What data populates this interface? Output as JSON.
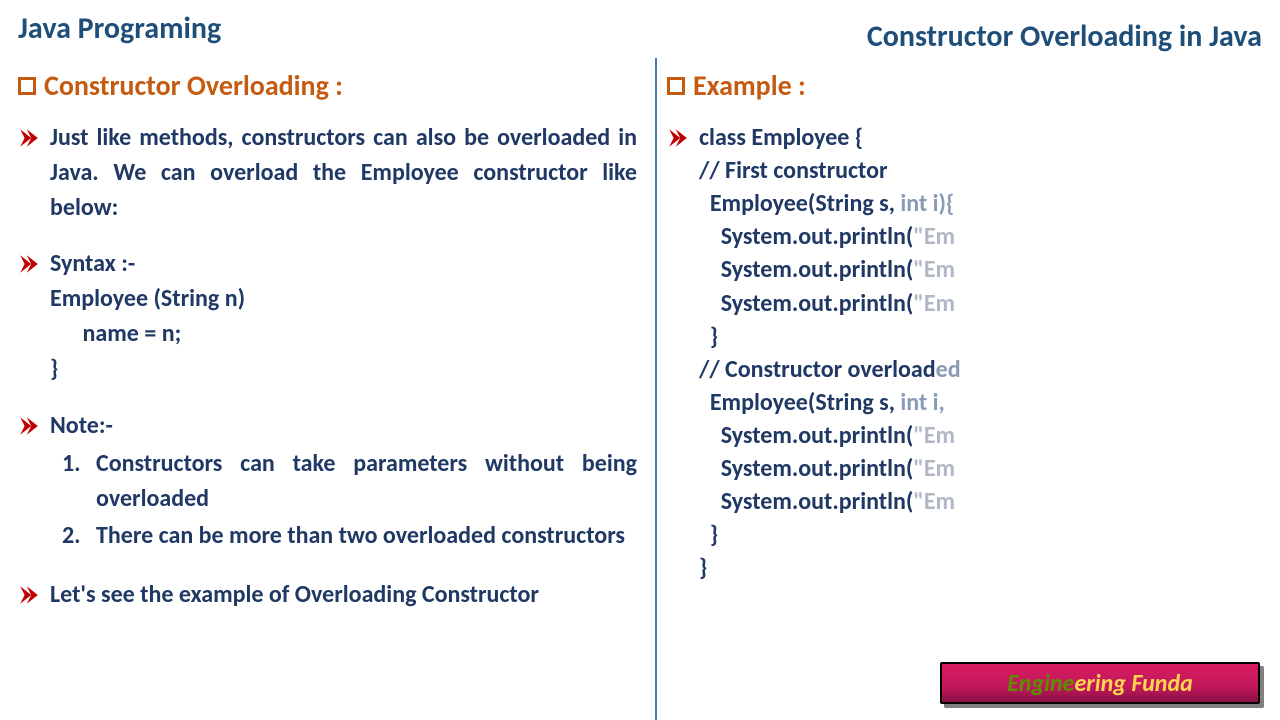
{
  "header": {
    "left": "Java Programing",
    "right": "Constructor Overloading in Java"
  },
  "left": {
    "title": "Constructor Overloading :",
    "para1": "Just like methods, constructors can also be overloaded in Java. We can overload the Employee constructor like below:",
    "syntax_label": "Syntax :-",
    "syntax_l1": "Employee (String n)",
    "syntax_l2": "      name = n;",
    "syntax_l3": "}",
    "note_label": "Note:-",
    "note1": "Constructors can take parameters without being overloaded",
    "note2": "There can be more than two overloaded constructors",
    "para2": "Let's see the example of Overloading Constructor"
  },
  "right": {
    "title": "Example :",
    "code": {
      "l1": "class Employee {",
      "l2": "// First constructor",
      "l3a": "  Employee(String s, ",
      "l3b": "int i){",
      "l4a": "    System.out.println(",
      "l4b": "\"Em",
      "l5a": "    System.out.println(",
      "l5b": "\"Em",
      "l6a": "    System.out.println(",
      "l6b": "\"Em",
      "l7": "  }",
      "l8a": "// Constructor overload",
      "l8b": "ed",
      "l9a": "  Employee(String s, ",
      "l9b": "int i,",
      "l10a": "    System.out.println(",
      "l10b": "\"Em",
      "l11a": "    System.out.println(",
      "l11b": "\"Em",
      "l12a": "    System.out.println(",
      "l12b": "\"Em",
      "l13": "  }",
      "l14": "}"
    }
  },
  "footer": {
    "part1": "Engine",
    "part2": "ering Funda"
  }
}
